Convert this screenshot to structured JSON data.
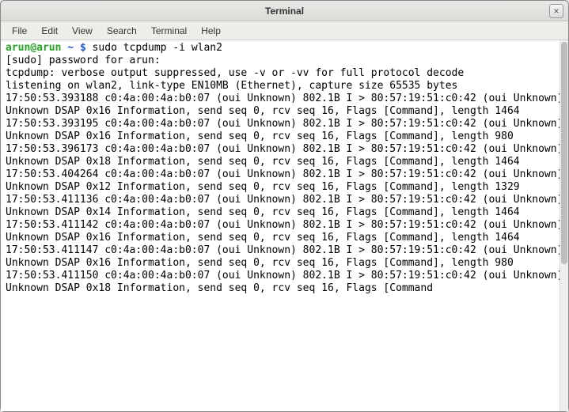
{
  "window": {
    "title": "Terminal",
    "close_label": "×"
  },
  "menubar": {
    "items": [
      "File",
      "Edit",
      "View",
      "Search",
      "Terminal",
      "Help"
    ]
  },
  "prompt": {
    "user_host": "arun@arun",
    "cwd": "~",
    "symbol": "$",
    "command": "sudo tcpdump -i wlan2"
  },
  "output": {
    "lines": [
      "[sudo] password for arun:",
      "tcpdump: verbose output suppressed, use -v or -vv for full protocol decode",
      "listening on wlan2, link-type EN10MB (Ethernet), capture size 65535 bytes",
      "17:50:53.393188 c0:4a:00:4a:b0:07 (oui Unknown) 802.1B I > 80:57:19:51:c0:42 (oui Unknown) Unknown DSAP 0x16 Information, send seq 0, rcv seq 16, Flags [Command], length 1464",
      "17:50:53.393195 c0:4a:00:4a:b0:07 (oui Unknown) 802.1B I > 80:57:19:51:c0:42 (oui Unknown) Unknown DSAP 0x16 Information, send seq 0, rcv seq 16, Flags [Command], length 980",
      "17:50:53.396173 c0:4a:00:4a:b0:07 (oui Unknown) 802.1B I > 80:57:19:51:c0:42 (oui Unknown) Unknown DSAP 0x18 Information, send seq 0, rcv seq 16, Flags [Command], length 1464",
      "17:50:53.404264 c0:4a:00:4a:b0:07 (oui Unknown) 802.1B I > 80:57:19:51:c0:42 (oui Unknown) Unknown DSAP 0x12 Information, send seq 0, rcv seq 16, Flags [Command], length 1329",
      "17:50:53.411136 c0:4a:00:4a:b0:07 (oui Unknown) 802.1B I > 80:57:19:51:c0:42 (oui Unknown) Unknown DSAP 0x14 Information, send seq 0, rcv seq 16, Flags [Command], length 1464",
      "17:50:53.411142 c0:4a:00:4a:b0:07 (oui Unknown) 802.1B I > 80:57:19:51:c0:42 (oui Unknown) Unknown DSAP 0x16 Information, send seq 0, rcv seq 16, Flags [Command], length 1464",
      "17:50:53.411147 c0:4a:00:4a:b0:07 (oui Unknown) 802.1B I > 80:57:19:51:c0:42 (oui Unknown) Unknown DSAP 0x16 Information, send seq 0, rcv seq 16, Flags [Command], length 980",
      "17:50:53.411150 c0:4a:00:4a:b0:07 (oui Unknown) 802.1B I > 80:57:19:51:c0:42 (oui Unknown) Unknown DSAP 0x18 Information, send seq 0, rcv seq 16, Flags [Command"
    ]
  }
}
